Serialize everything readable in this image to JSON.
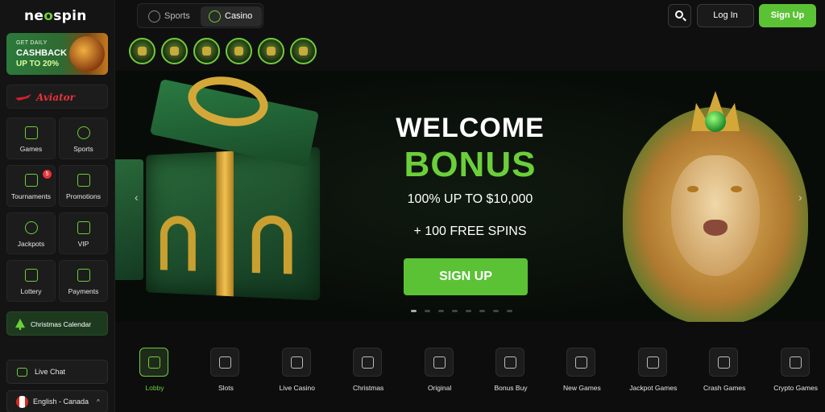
{
  "brand": {
    "logo": "neospin"
  },
  "sidebar": {
    "promo": {
      "line1": "GET DAILY",
      "line2": "CASHBACK",
      "line3": "UP TO 20%"
    },
    "aviator_label": "Aviator",
    "grid": [
      {
        "label": "Games",
        "icon": "dice-icon"
      },
      {
        "label": "Sports",
        "icon": "soccer-ball-icon"
      },
      {
        "label": "Tournaments",
        "icon": "trophy-icon",
        "badge": "5"
      },
      {
        "label": "Promotions",
        "icon": "gift-icon"
      },
      {
        "label": "Jackpots",
        "icon": "money-bag-icon"
      },
      {
        "label": "VIP",
        "icon": "star-icon"
      },
      {
        "label": "Lottery",
        "icon": "ticket-icon"
      },
      {
        "label": "Payments",
        "icon": "wallet-icon"
      }
    ],
    "christmas_calendar": "Christmas Calendar",
    "live_chat": "Live Chat",
    "language": "English - Canada"
  },
  "header": {
    "tabs": [
      {
        "label": "Sports",
        "active": false
      },
      {
        "label": "Casino",
        "active": true
      }
    ],
    "login": "Log In",
    "signup": "Sign Up",
    "quick_chips": [
      "trophy-chip",
      "crown-chip",
      "gift-chip",
      "wheel-chip",
      "box-chip",
      "seven-chip"
    ]
  },
  "hero": {
    "title": "WELCOME",
    "bonus": "BONUS",
    "amount": "100% UP TO $10,000",
    "spins": "+ 100 FREE SPINS",
    "cta": "SIGN UP",
    "slide_count": 8,
    "active_slide": 0
  },
  "categories": [
    {
      "label": "Lobby",
      "active": true
    },
    {
      "label": "Slots",
      "active": false
    },
    {
      "label": "Live Casino",
      "active": false
    },
    {
      "label": "Christmas",
      "active": false
    },
    {
      "label": "Original",
      "active": false
    },
    {
      "label": "Bonus Buy",
      "active": false
    },
    {
      "label": "New Games",
      "active": false
    },
    {
      "label": "Jackpot Games",
      "active": false
    },
    {
      "label": "Crash Games",
      "active": false
    },
    {
      "label": "Crypto Games",
      "active": false
    }
  ],
  "colors": {
    "accent": "#5bc236",
    "background": "#0d0d0d",
    "badge": "#e8323c"
  }
}
